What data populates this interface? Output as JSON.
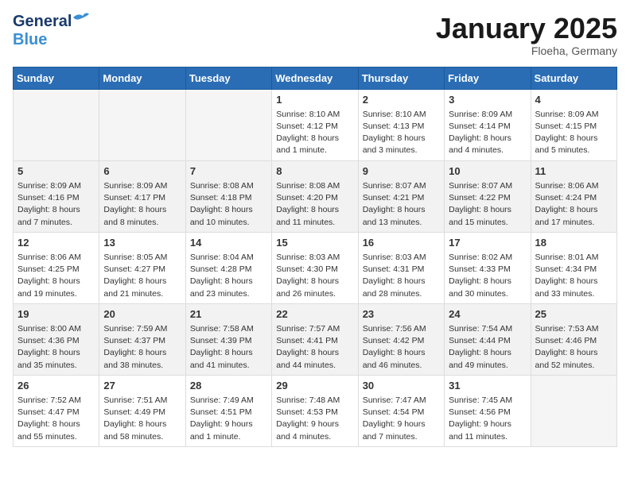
{
  "header": {
    "logo_general": "General",
    "logo_blue": "Blue",
    "month": "January 2025",
    "location": "Floeha, Germany"
  },
  "weekdays": [
    "Sunday",
    "Monday",
    "Tuesday",
    "Wednesday",
    "Thursday",
    "Friday",
    "Saturday"
  ],
  "weeks": [
    [
      {
        "num": "",
        "info": ""
      },
      {
        "num": "",
        "info": ""
      },
      {
        "num": "",
        "info": ""
      },
      {
        "num": "1",
        "info": "Sunrise: 8:10 AM\nSunset: 4:12 PM\nDaylight: 8 hours\nand 1 minute."
      },
      {
        "num": "2",
        "info": "Sunrise: 8:10 AM\nSunset: 4:13 PM\nDaylight: 8 hours\nand 3 minutes."
      },
      {
        "num": "3",
        "info": "Sunrise: 8:09 AM\nSunset: 4:14 PM\nDaylight: 8 hours\nand 4 minutes."
      },
      {
        "num": "4",
        "info": "Sunrise: 8:09 AM\nSunset: 4:15 PM\nDaylight: 8 hours\nand 5 minutes."
      }
    ],
    [
      {
        "num": "5",
        "info": "Sunrise: 8:09 AM\nSunset: 4:16 PM\nDaylight: 8 hours\nand 7 minutes."
      },
      {
        "num": "6",
        "info": "Sunrise: 8:09 AM\nSunset: 4:17 PM\nDaylight: 8 hours\nand 8 minutes."
      },
      {
        "num": "7",
        "info": "Sunrise: 8:08 AM\nSunset: 4:18 PM\nDaylight: 8 hours\nand 10 minutes."
      },
      {
        "num": "8",
        "info": "Sunrise: 8:08 AM\nSunset: 4:20 PM\nDaylight: 8 hours\nand 11 minutes."
      },
      {
        "num": "9",
        "info": "Sunrise: 8:07 AM\nSunset: 4:21 PM\nDaylight: 8 hours\nand 13 minutes."
      },
      {
        "num": "10",
        "info": "Sunrise: 8:07 AM\nSunset: 4:22 PM\nDaylight: 8 hours\nand 15 minutes."
      },
      {
        "num": "11",
        "info": "Sunrise: 8:06 AM\nSunset: 4:24 PM\nDaylight: 8 hours\nand 17 minutes."
      }
    ],
    [
      {
        "num": "12",
        "info": "Sunrise: 8:06 AM\nSunset: 4:25 PM\nDaylight: 8 hours\nand 19 minutes."
      },
      {
        "num": "13",
        "info": "Sunrise: 8:05 AM\nSunset: 4:27 PM\nDaylight: 8 hours\nand 21 minutes."
      },
      {
        "num": "14",
        "info": "Sunrise: 8:04 AM\nSunset: 4:28 PM\nDaylight: 8 hours\nand 23 minutes."
      },
      {
        "num": "15",
        "info": "Sunrise: 8:03 AM\nSunset: 4:30 PM\nDaylight: 8 hours\nand 26 minutes."
      },
      {
        "num": "16",
        "info": "Sunrise: 8:03 AM\nSunset: 4:31 PM\nDaylight: 8 hours\nand 28 minutes."
      },
      {
        "num": "17",
        "info": "Sunrise: 8:02 AM\nSunset: 4:33 PM\nDaylight: 8 hours\nand 30 minutes."
      },
      {
        "num": "18",
        "info": "Sunrise: 8:01 AM\nSunset: 4:34 PM\nDaylight: 8 hours\nand 33 minutes."
      }
    ],
    [
      {
        "num": "19",
        "info": "Sunrise: 8:00 AM\nSunset: 4:36 PM\nDaylight: 8 hours\nand 35 minutes."
      },
      {
        "num": "20",
        "info": "Sunrise: 7:59 AM\nSunset: 4:37 PM\nDaylight: 8 hours\nand 38 minutes."
      },
      {
        "num": "21",
        "info": "Sunrise: 7:58 AM\nSunset: 4:39 PM\nDaylight: 8 hours\nand 41 minutes."
      },
      {
        "num": "22",
        "info": "Sunrise: 7:57 AM\nSunset: 4:41 PM\nDaylight: 8 hours\nand 44 minutes."
      },
      {
        "num": "23",
        "info": "Sunrise: 7:56 AM\nSunset: 4:42 PM\nDaylight: 8 hours\nand 46 minutes."
      },
      {
        "num": "24",
        "info": "Sunrise: 7:54 AM\nSunset: 4:44 PM\nDaylight: 8 hours\nand 49 minutes."
      },
      {
        "num": "25",
        "info": "Sunrise: 7:53 AM\nSunset: 4:46 PM\nDaylight: 8 hours\nand 52 minutes."
      }
    ],
    [
      {
        "num": "26",
        "info": "Sunrise: 7:52 AM\nSunset: 4:47 PM\nDaylight: 8 hours\nand 55 minutes."
      },
      {
        "num": "27",
        "info": "Sunrise: 7:51 AM\nSunset: 4:49 PM\nDaylight: 8 hours\nand 58 minutes."
      },
      {
        "num": "28",
        "info": "Sunrise: 7:49 AM\nSunset: 4:51 PM\nDaylight: 9 hours\nand 1 minute."
      },
      {
        "num": "29",
        "info": "Sunrise: 7:48 AM\nSunset: 4:53 PM\nDaylight: 9 hours\nand 4 minutes."
      },
      {
        "num": "30",
        "info": "Sunrise: 7:47 AM\nSunset: 4:54 PM\nDaylight: 9 hours\nand 7 minutes."
      },
      {
        "num": "31",
        "info": "Sunrise: 7:45 AM\nSunset: 4:56 PM\nDaylight: 9 hours\nand 11 minutes."
      },
      {
        "num": "",
        "info": ""
      }
    ]
  ]
}
